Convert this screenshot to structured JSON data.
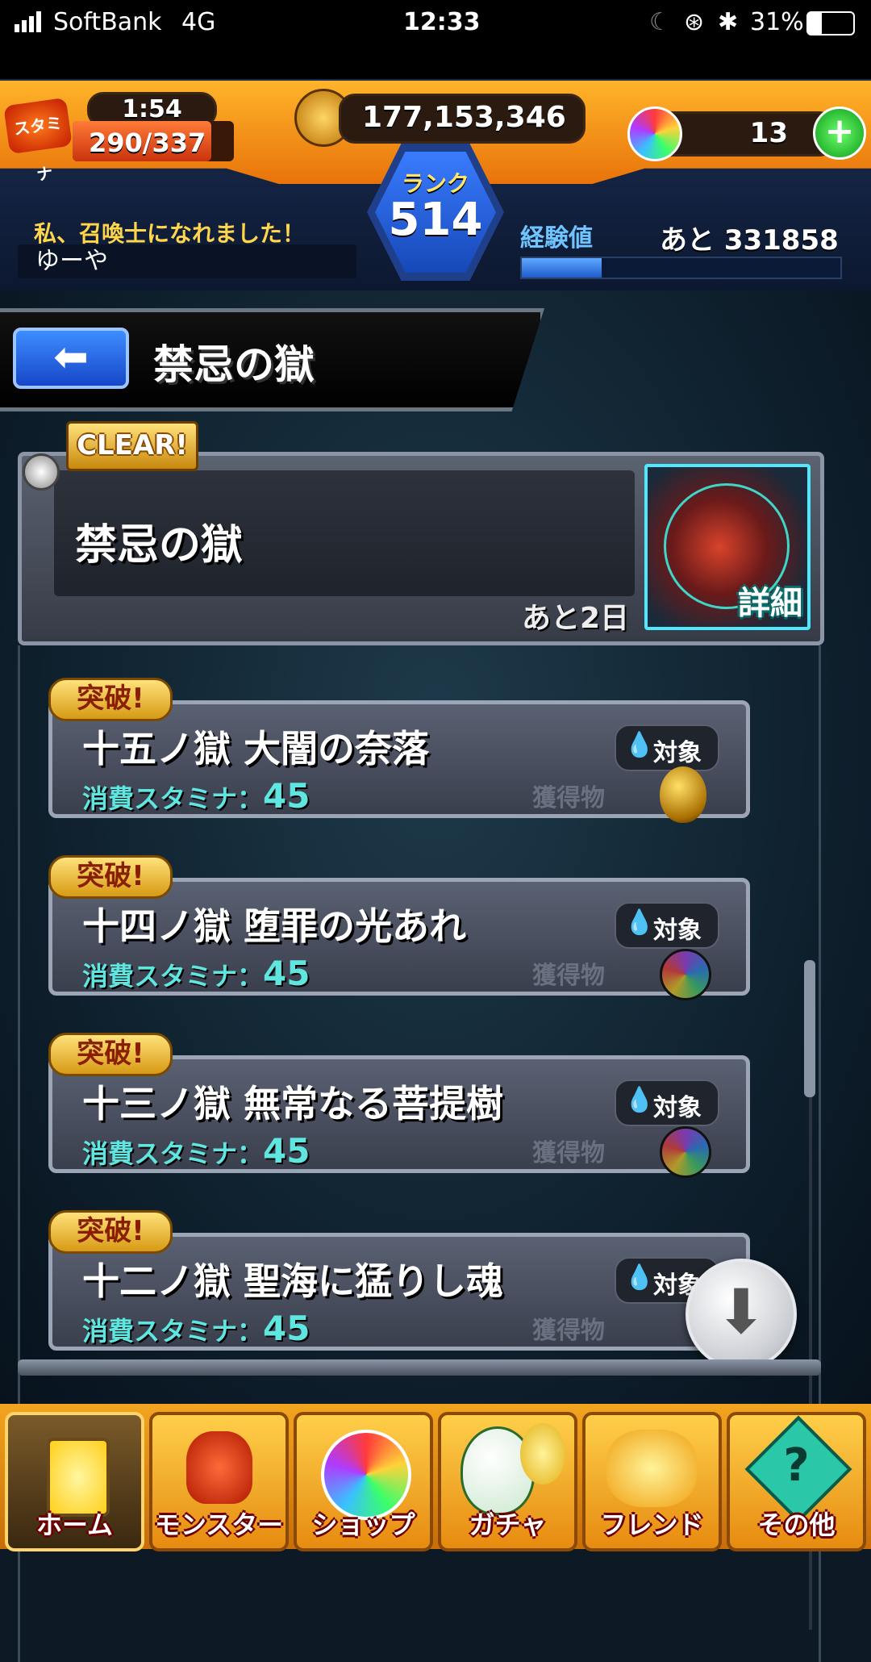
{
  "status_bar": {
    "carrier": "SoftBank",
    "network": "4G",
    "time": "12:33",
    "battery": "31%"
  },
  "hud": {
    "stamina_label": "スタミナ",
    "stamina_timer": "1:54",
    "stamina_value": "290/337",
    "gold": "177,153,346",
    "orbs": "13",
    "rank_label": "ランク",
    "rank_value": "514",
    "player_title": "私、召喚士になれました！",
    "player_name": "ゆーや",
    "exp_label": "経験値",
    "exp_remaining": "あと 331858",
    "exp_progress": 0.25
  },
  "page": {
    "title": "禁忌の獄"
  },
  "event": {
    "clear_badge": "CLEAR!",
    "name": "禁忌の獄",
    "remaining": "あと2日",
    "detail_label": "詳細"
  },
  "quests": [
    {
      "badge": "突破!",
      "name": "十五ノ獄 大闇の奈落",
      "target": "対象",
      "stamina_label": "消費スタミナ：",
      "stamina": "45",
      "loot_label": "獲得物"
    },
    {
      "badge": "突破!",
      "name": "十四ノ獄 堕罪の光あれ",
      "target": "対象",
      "stamina_label": "消費スタミナ：",
      "stamina": "45",
      "loot_label": "獲得物"
    },
    {
      "badge": "突破!",
      "name": "十三ノ獄 無常なる菩提樹",
      "target": "対象",
      "stamina_label": "消費スタミナ：",
      "stamina": "45",
      "loot_label": "獲得物"
    },
    {
      "badge": "突破!",
      "name": "十二ノ獄 聖海に猛りし魂",
      "target": "対象",
      "stamina_label": "消費スタミナ：",
      "stamina": "45",
      "loot_label": "獲得物"
    }
  ],
  "nav": [
    {
      "label": "ホーム",
      "icon": "home-icon"
    },
    {
      "label": "モンスター",
      "icon": "monster-icon"
    },
    {
      "label": "ショップ",
      "icon": "shop-icon"
    },
    {
      "label": "ガチャ",
      "icon": "gacha-icon"
    },
    {
      "label": "フレンド",
      "icon": "friend-icon"
    },
    {
      "label": "その他",
      "icon": "other-icon"
    }
  ],
  "colors": {
    "accent_orange": "#e8730a",
    "stamina_cyan": "#5fe6e0",
    "badge_gold": "#d79a14",
    "exp_blue": "#2a7fff"
  }
}
